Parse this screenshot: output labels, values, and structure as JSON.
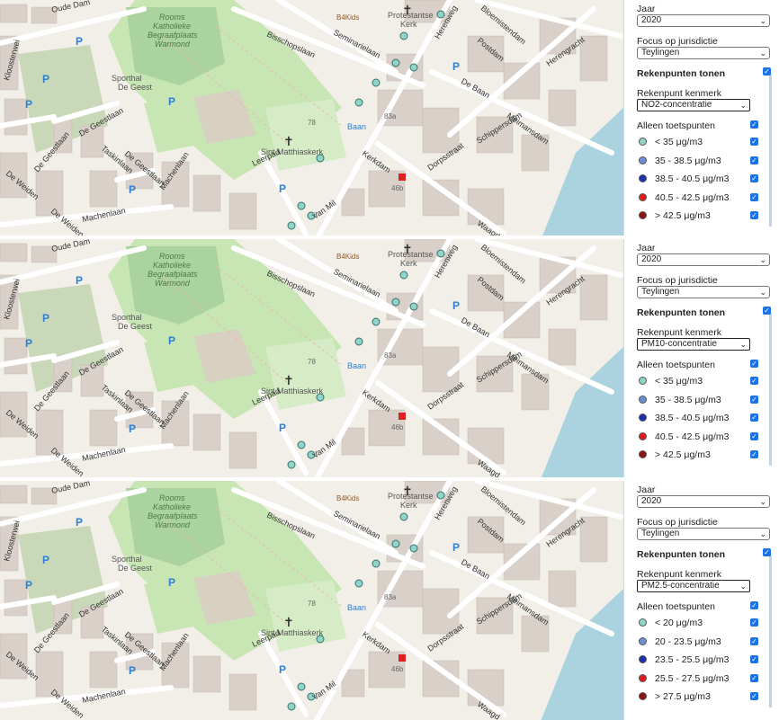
{
  "panels": [
    {
      "jaar_label": "Jaar",
      "jaar_value": "2020",
      "focus_label": "Focus op jurisdictie",
      "focus_value": "Teylingen",
      "rekenpunten_label": "Rekenpunten tonen",
      "kenmerk_label": "Rekenpunt kenmerk",
      "kenmerk_value": "NO2-concentratie",
      "toetspunten_label": "Alleen toetspunten",
      "legend": [
        {
          "label": "< 35 μg/m3",
          "color": "#8fd3c9"
        },
        {
          "label": "35 - 38.5 μg/m3",
          "color": "#6a8fd6"
        },
        {
          "label": "38.5 - 40.5 μg/m3",
          "color": "#1c2fb0"
        },
        {
          "label": "40.5 - 42.5 μg/m3",
          "color": "#e01a1a"
        },
        {
          "label": "> 42.5 μg/m3",
          "color": "#8e1212"
        }
      ]
    },
    {
      "jaar_label": "Jaar",
      "jaar_value": "2020",
      "focus_label": "Focus op jurisdictie",
      "focus_value": "Teylingen",
      "rekenpunten_label": "Rekenpunten tonen",
      "kenmerk_label": "Rekenpunt kenmerk",
      "kenmerk_value": "PM10-concentratie",
      "toetspunten_label": "Alleen toetspunten",
      "legend": [
        {
          "label": "< 35 μg/m3",
          "color": "#8fd3c9"
        },
        {
          "label": "35 - 38.5 μg/m3",
          "color": "#6a8fd6"
        },
        {
          "label": "38.5 - 40.5 μg/m3",
          "color": "#1c2fb0"
        },
        {
          "label": "40.5 - 42.5 μg/m3",
          "color": "#e01a1a"
        },
        {
          "label": "> 42.5 μg/m3",
          "color": "#8e1212"
        }
      ]
    },
    {
      "jaar_label": "Jaar",
      "jaar_value": "2020",
      "focus_label": "Focus op jurisdictie",
      "focus_value": "Teylingen",
      "rekenpunten_label": "Rekenpunten tonen",
      "kenmerk_label": "Rekenpunt kenmerk",
      "kenmerk_value": "PM2.5-concentratie",
      "toetspunten_label": "Alleen toetspunten",
      "legend": [
        {
          "label": "< 20 μg/m3",
          "color": "#8fd3c9"
        },
        {
          "label": "20 - 23.5 μg/m3",
          "color": "#6a8fd6"
        },
        {
          "label": "23.5 - 25.5 μg/m3",
          "color": "#1c2fb0"
        },
        {
          "label": "25.5 - 27.5 μg/m3",
          "color": "#e01a1a"
        },
        {
          "label": "> 27.5 μg/m3",
          "color": "#8e1212"
        }
      ]
    }
  ],
  "map_labels": {
    "oude_dam": "Oude Dam",
    "rooms": "Rooms",
    "katholieke": "Katholieke",
    "begraafplaats": "Begraafplaats",
    "warmond": "Warmond",
    "bisschopslaan": "Bisschopslaan",
    "seminarielaan": "Seminarielaan",
    "b4kids": "B4Kids",
    "protestantse": "Protestantse",
    "kerk": "Kerk",
    "herenweg": "Herenweg",
    "bloemistendam": "Bloemistendam",
    "postdam": "Postdam",
    "de_baan": "De Baan",
    "herengracht": "Herengracht",
    "sporthal": "Sporthal",
    "de_geest": "De Geest",
    "de_geestlaan": "De Geestlaan",
    "taskinlaan": "Taskinlaan",
    "machenlaan": "Machenlaan",
    "de_weiden": "De Weiden",
    "sint_matthiaskerk": "Sint Matthiaskerk",
    "leerpad": "Leerpad",
    "baan": "Baan",
    "kerkdam": "Kerkdam",
    "dorpsstraat": "Dorpsstraat",
    "schippersdam": "Schippersdam",
    "meimansdam": "Meimansdam",
    "van_mil": "Van Mil",
    "waagd": "Waagd",
    "kloosterwei": "Kloosterwei",
    "num_78": "78",
    "num_46b": "46b",
    "num_83a": "83a"
  },
  "colors": {
    "checkbox": "#1a73e8",
    "map_bg": "#f2efe9",
    "park": "#c8e6b4",
    "cemetery": "#aad3a0",
    "building": "#d9d0c9",
    "water": "#aad3df",
    "road": "#ffffff"
  }
}
